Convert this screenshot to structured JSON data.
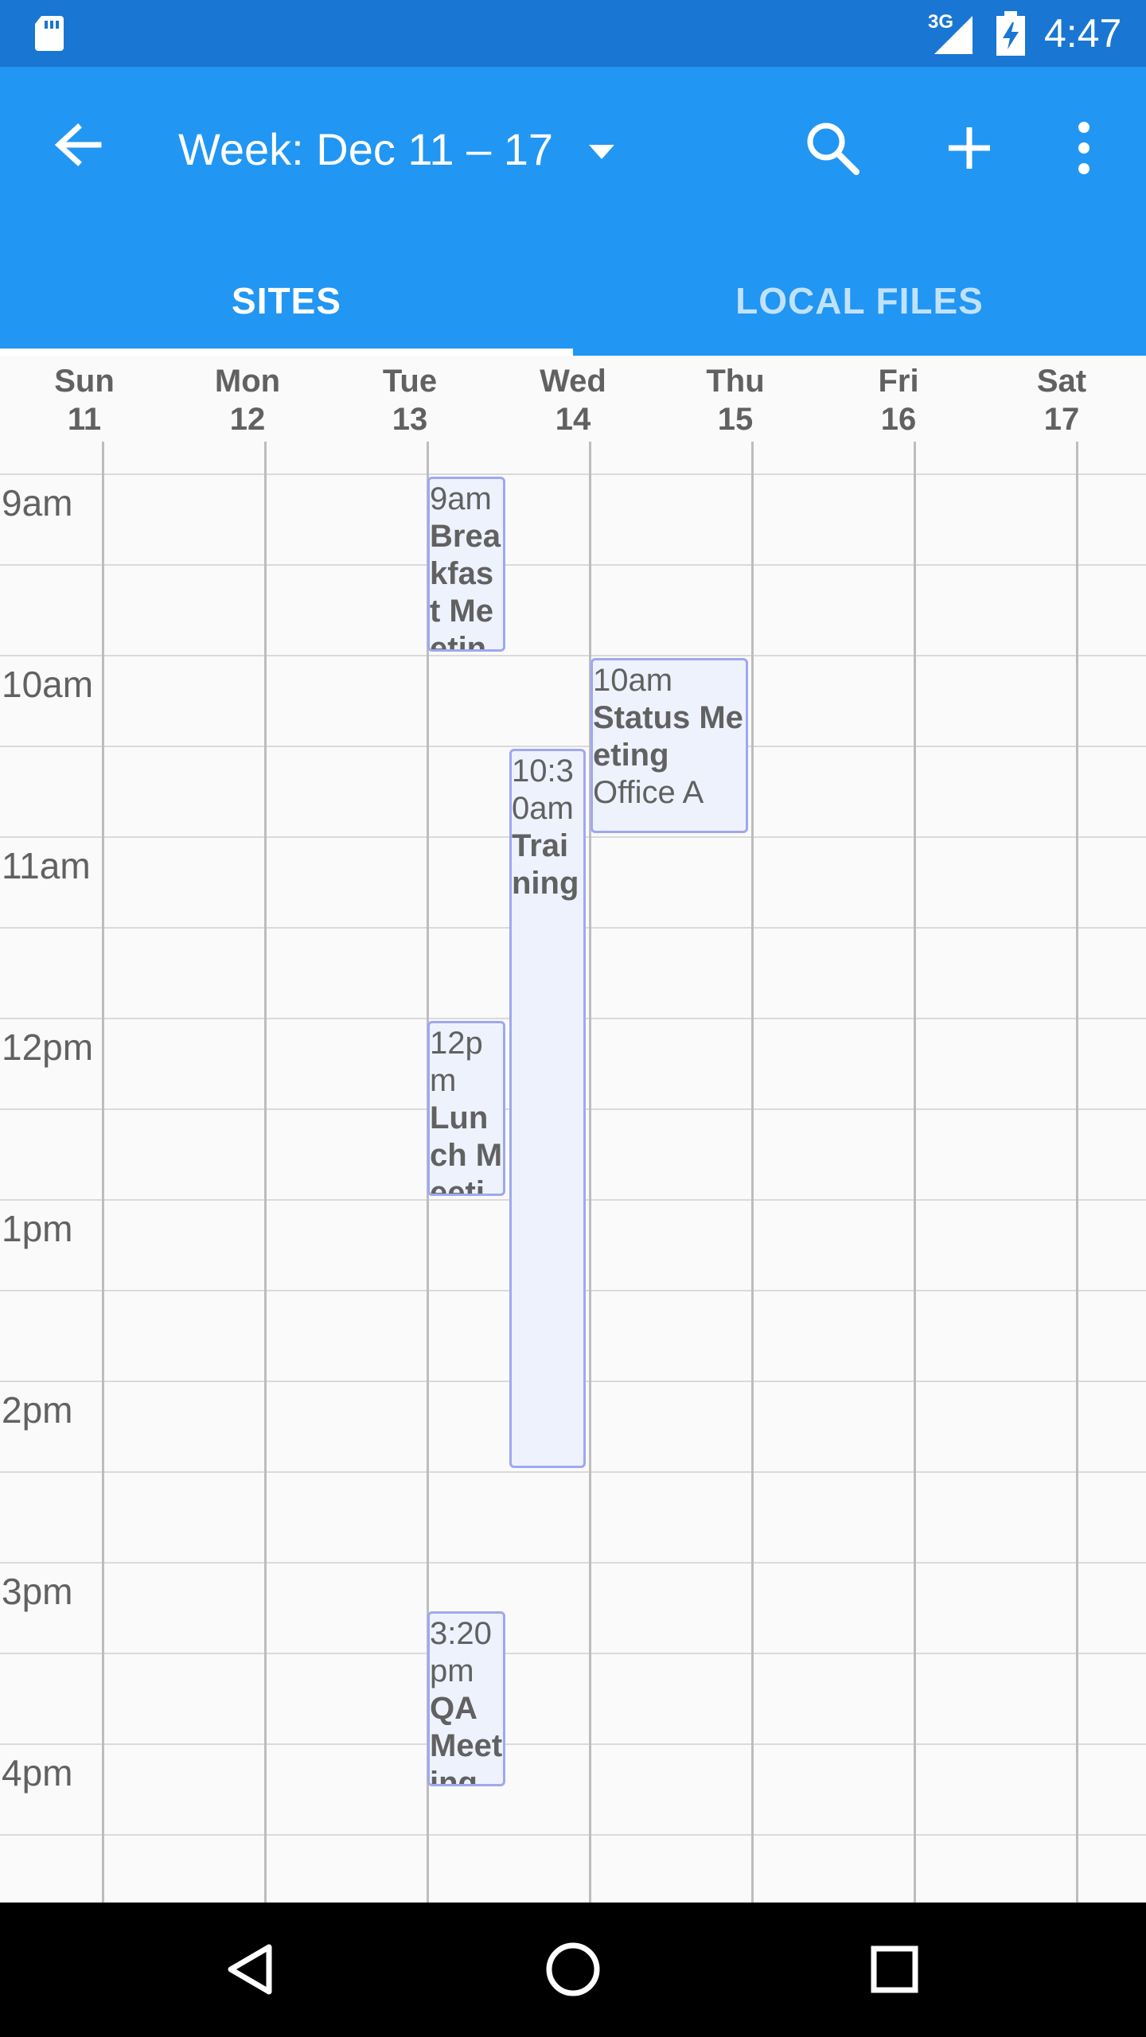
{
  "status_bar": {
    "network_label": "3G",
    "time": "4:47",
    "icons": [
      "sd-card-icon",
      "cell-signal-icon",
      "battery-charging-icon"
    ]
  },
  "app_bar": {
    "title": "Week: Dec 11 – 17",
    "icons": [
      "back-arrow-icon",
      "dropdown-arrow-icon",
      "search-icon",
      "add-icon",
      "more-vert-icon"
    ],
    "background_color": "#2196f3"
  },
  "tabs": [
    {
      "label": "SITES",
      "selected": true
    },
    {
      "label": "LOCAL FILES",
      "selected": false
    }
  ],
  "week": {
    "days": [
      {
        "name": "Sun",
        "date": "11"
      },
      {
        "name": "Mon",
        "date": "12"
      },
      {
        "name": "Tue",
        "date": "13"
      },
      {
        "name": "Wed",
        "date": "14"
      },
      {
        "name": "Thu",
        "date": "15"
      },
      {
        "name": "Fri",
        "date": "16"
      },
      {
        "name": "Sat",
        "date": "17"
      }
    ],
    "hours": [
      "9am",
      "10am",
      "11am",
      "12pm",
      "1pm",
      "2pm",
      "3pm",
      "4pm"
    ]
  },
  "events": [
    {
      "time": "9am",
      "name": "Breakfast Meeting",
      "location": ""
    },
    {
      "time": "10am",
      "name": "Status Meeting",
      "location": "Office A"
    },
    {
      "time": "10:30am",
      "name": "Training",
      "location": ""
    },
    {
      "time": "12pm",
      "name": "Lunch Meeting",
      "location": ""
    },
    {
      "time": "3:20pm",
      "name": "QA Meeting",
      "location": ""
    }
  ],
  "nav_bar": {
    "icons": [
      "back-triangle-icon",
      "home-circle-icon",
      "recents-square-icon"
    ]
  }
}
